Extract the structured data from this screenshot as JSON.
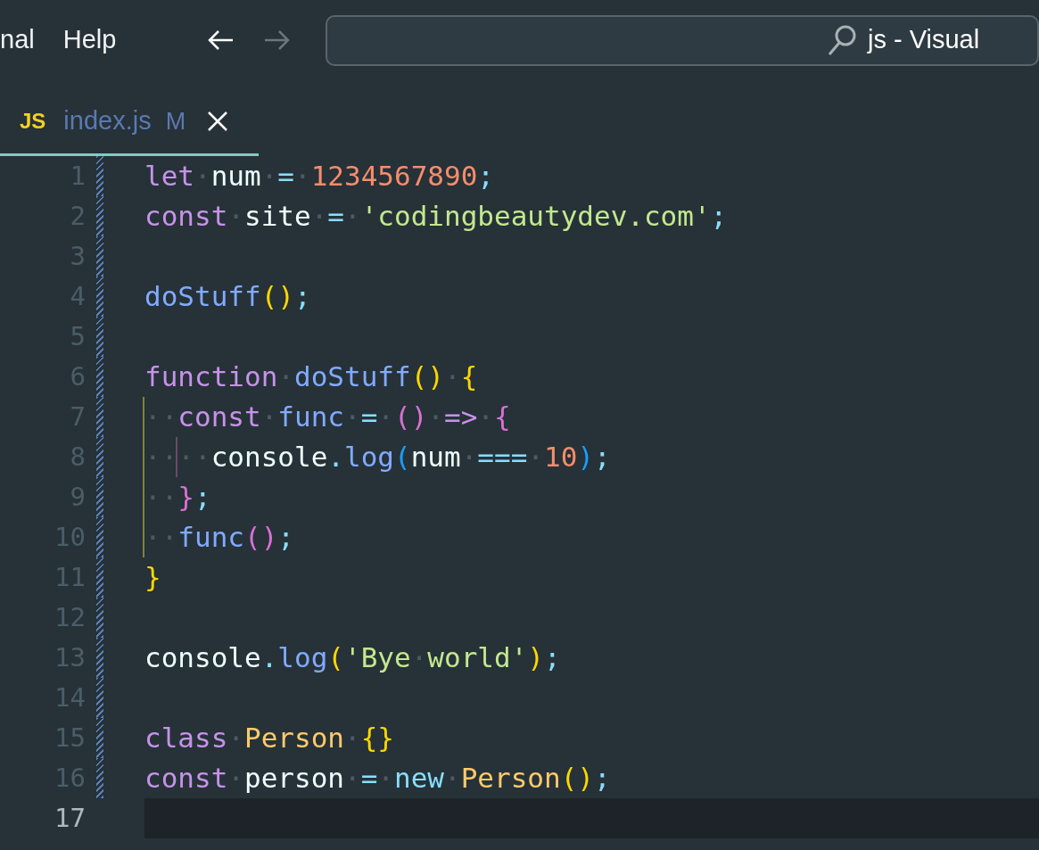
{
  "menu": [
    {
      "label": "nal"
    },
    {
      "label": "Help"
    }
  ],
  "nav": [
    {
      "kind": "back",
      "disabled": false
    },
    {
      "kind": "forward",
      "disabled": true
    }
  ],
  "command_center": {
    "text": "js - Visual"
  },
  "tabs": [
    {
      "icon_text": "JS",
      "label": "index.js",
      "badge": "M",
      "selected": true
    }
  ],
  "editor": {
    "lines": [
      {
        "number": "1",
        "current": false,
        "modified": true,
        "tokens": [
          {
            "kind": "kw",
            "text": "let"
          },
          {
            "kind": "ws",
            "text": "·"
          },
          {
            "kind": "var",
            "text": "num"
          },
          {
            "kind": "ws",
            "text": "·"
          },
          {
            "kind": "op",
            "text": "="
          },
          {
            "kind": "ws",
            "text": "·"
          },
          {
            "kind": "num",
            "text": "1234567890"
          },
          {
            "kind": "op",
            "text": ";"
          }
        ]
      },
      {
        "number": "2",
        "current": false,
        "modified": true,
        "tokens": [
          {
            "kind": "kw",
            "text": "const"
          },
          {
            "kind": "ws",
            "text": "·"
          },
          {
            "kind": "var",
            "text": "site"
          },
          {
            "kind": "ws",
            "text": "·"
          },
          {
            "kind": "op",
            "text": "="
          },
          {
            "kind": "ws",
            "text": "·"
          },
          {
            "kind": "str",
            "text": "'codingbeautydev.com'"
          },
          {
            "kind": "op",
            "text": ";"
          }
        ]
      },
      {
        "number": "3",
        "current": false,
        "modified": true
      },
      {
        "number": "4",
        "current": false,
        "modified": true,
        "tokens": [
          {
            "kind": "fn",
            "text": "doStuff"
          },
          {
            "kind": "b1",
            "text": "()"
          },
          {
            "kind": "op",
            "text": ";"
          }
        ]
      },
      {
        "number": "5",
        "current": false,
        "modified": true
      },
      {
        "number": "6",
        "current": false,
        "modified": true,
        "tokens": [
          {
            "kind": "kw",
            "text": "function"
          },
          {
            "kind": "ws",
            "text": "·"
          },
          {
            "kind": "fn",
            "text": "doStuff"
          },
          {
            "kind": "b1",
            "text": "()"
          },
          {
            "kind": "ws",
            "text": "·"
          },
          {
            "kind": "b1",
            "text": "{"
          }
        ]
      },
      {
        "number": "7",
        "current": false,
        "modified": true,
        "tokens": [
          {
            "kind": "indent",
            "text": "··",
            "color": "#857f3c"
          },
          {
            "kind": "kw",
            "text": "const"
          },
          {
            "kind": "ws",
            "text": "·"
          },
          {
            "kind": "fn",
            "text": "func"
          },
          {
            "kind": "ws",
            "text": "·"
          },
          {
            "kind": "op",
            "text": "="
          },
          {
            "kind": "ws",
            "text": "·"
          },
          {
            "kind": "b2",
            "text": "()"
          },
          {
            "kind": "ws",
            "text": "·"
          },
          {
            "kind": "kw",
            "text": "=>"
          },
          {
            "kind": "ws",
            "text": "·"
          },
          {
            "kind": "b2",
            "text": "{"
          }
        ]
      },
      {
        "number": "8",
        "current": false,
        "modified": true,
        "tokens": [
          {
            "kind": "indent",
            "text": "··",
            "color": "#857f3c"
          },
          {
            "kind": "indent",
            "text": "··",
            "color": "#6b4a6b"
          },
          {
            "kind": "var",
            "text": "console"
          },
          {
            "kind": "op",
            "text": "."
          },
          {
            "kind": "fn",
            "text": "log"
          },
          {
            "kind": "b3",
            "text": "("
          },
          {
            "kind": "var",
            "text": "num"
          },
          {
            "kind": "ws",
            "text": "·"
          },
          {
            "kind": "op",
            "text": "==="
          },
          {
            "kind": "ws",
            "text": "·"
          },
          {
            "kind": "num",
            "text": "10"
          },
          {
            "kind": "b3",
            "text": ")"
          },
          {
            "kind": "op",
            "text": ";"
          }
        ]
      },
      {
        "number": "9",
        "current": false,
        "modified": true,
        "tokens": [
          {
            "kind": "indent",
            "text": "··",
            "color": "#857f3c"
          },
          {
            "kind": "b2",
            "text": "}"
          },
          {
            "kind": "op",
            "text": ";"
          }
        ]
      },
      {
        "number": "10",
        "current": false,
        "modified": true,
        "tokens": [
          {
            "kind": "indent",
            "text": "··",
            "color": "#857f3c"
          },
          {
            "kind": "fn",
            "text": "func"
          },
          {
            "kind": "b2",
            "text": "()"
          },
          {
            "kind": "op",
            "text": ";"
          }
        ]
      },
      {
        "number": "11",
        "current": false,
        "modified": true,
        "tokens": [
          {
            "kind": "b1",
            "text": "}"
          }
        ]
      },
      {
        "number": "12",
        "current": false,
        "modified": true
      },
      {
        "number": "13",
        "current": false,
        "modified": true,
        "tokens": [
          {
            "kind": "var",
            "text": "console"
          },
          {
            "kind": "op",
            "text": "."
          },
          {
            "kind": "fn",
            "text": "log"
          },
          {
            "kind": "b1",
            "text": "("
          },
          {
            "kind": "str",
            "text": "'Bye"
          },
          {
            "kind": "ws",
            "text": "·"
          },
          {
            "kind": "str",
            "text": "world'"
          },
          {
            "kind": "b1",
            "text": ")"
          },
          {
            "kind": "op",
            "text": ";"
          }
        ]
      },
      {
        "number": "14",
        "current": false,
        "modified": true
      },
      {
        "number": "15",
        "current": false,
        "modified": true,
        "tokens": [
          {
            "kind": "kw",
            "text": "class"
          },
          {
            "kind": "ws",
            "text": "·"
          },
          {
            "kind": "cls",
            "text": "Person"
          },
          {
            "kind": "ws",
            "text": "·"
          },
          {
            "kind": "b1",
            "text": "{}"
          }
        ]
      },
      {
        "number": "16",
        "current": false,
        "modified": true,
        "tokens": [
          {
            "kind": "kw",
            "text": "const"
          },
          {
            "kind": "ws",
            "text": "·"
          },
          {
            "kind": "var",
            "text": "person"
          },
          {
            "kind": "ws",
            "text": "·"
          },
          {
            "kind": "op",
            "text": "="
          },
          {
            "kind": "ws",
            "text": "·"
          },
          {
            "kind": "op",
            "text": "new"
          },
          {
            "kind": "ws",
            "text": "·"
          },
          {
            "kind": "cls",
            "text": "Person"
          },
          {
            "kind": "b1",
            "text": "()"
          },
          {
            "kind": "op",
            "text": ";"
          }
        ]
      },
      {
        "number": "17",
        "current": true,
        "modified": false
      }
    ]
  }
}
